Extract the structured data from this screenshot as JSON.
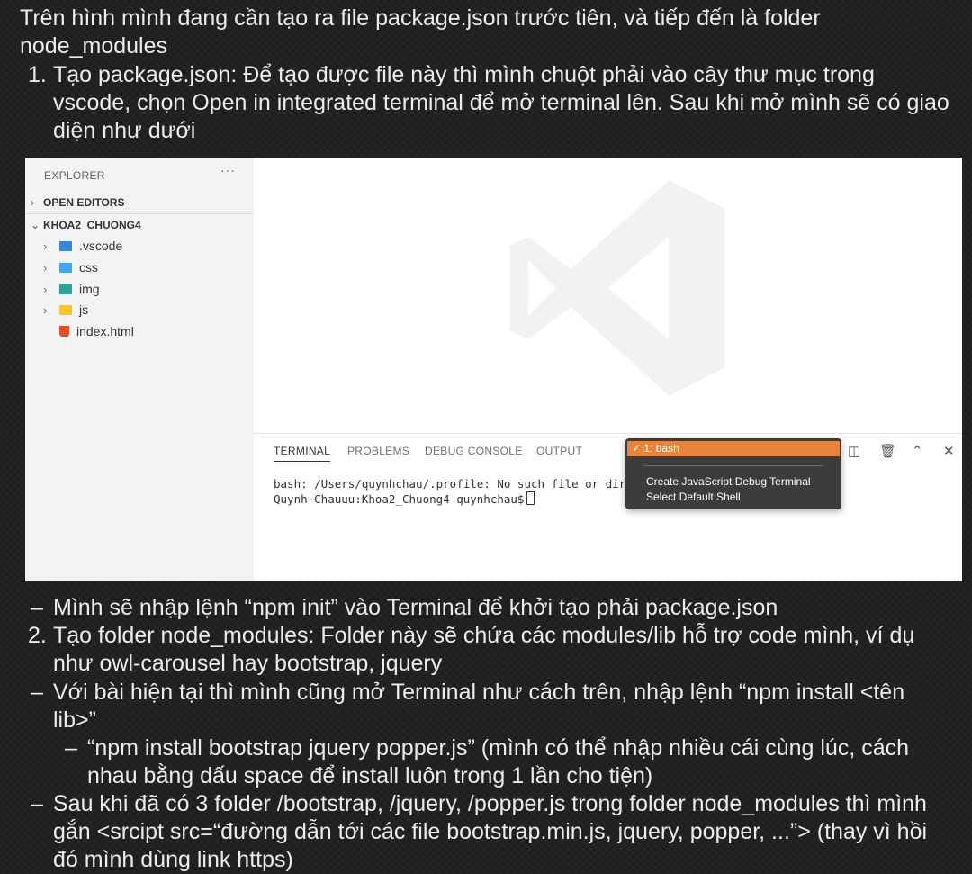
{
  "intro": {
    "line1": "Trên hình mình đang cần tạo ra file package.json trước tiên, và tiếp đến là folder",
    "line2": "node_modules"
  },
  "step1": {
    "number": "1.",
    "line1": "Tạo package.json: Để tạo được file này thì mình chuột phải vào cây thư mục trong",
    "line2": "vscode, chọn Open in integrated terminal để mở terminal lên. Sau khi mở mình sẽ có giao",
    "line3": "diện như dưới"
  },
  "vscode": {
    "explorer_title": "EXPLORER",
    "more": "···",
    "open_editors": "OPEN EDITORS",
    "project": "KHOA2_CHUONG4",
    "files": [
      {
        "name": ".vscode",
        "icon": "vscode-folder-icon",
        "color": "#3a86d6"
      },
      {
        "name": "css",
        "icon": "css-folder-icon",
        "color": "#42a5f5"
      },
      {
        "name": "img",
        "icon": "image-folder-icon",
        "color": "#26a69a"
      },
      {
        "name": "js",
        "icon": "js-folder-icon",
        "color": "#f9c623"
      },
      {
        "name": "index.html",
        "icon": "html5-icon",
        "color": "#e44d26"
      }
    ],
    "tabs": [
      "TERMINAL",
      "PROBLEMS",
      "DEBUG CONSOLE",
      "OUTPUT"
    ],
    "terminal_line1": "bash: /Users/quynhchau/.profile: No such file or dir",
    "terminal_line2": "Quynh-Chauuu:Khoa2_Chuong4 quynhchau$",
    "dropdown": {
      "selected": "1: bash",
      "option1": "Create JavaScript Debug Terminal",
      "option2": "Select Default Shell"
    },
    "accent_color": "#e8843a"
  },
  "notes": {
    "dash1": "Mình sẽ nhập lệnh “npm init” vào Terminal để khởi tạo phải package.json",
    "step2_number": "2.",
    "step2_line1": "Tạo folder node_modules: Folder này sẽ chứa các modules/lib hỗ trợ code mình, ví dụ",
    "step2_line2": "như owl-carousel hay bootstrap, jquery",
    "dash2_line1": "Với bài hiện tại thì mình cũng mở Terminal như cách trên, nhập lệnh “npm install <tên",
    "dash2_line2": "lib>”",
    "sub_line1": "“npm install bootstrap jquery popper.js” (mình có thể nhập nhiều cái cùng lúc, cách",
    "sub_line2": "nhau bằng dấu space để install luôn trong 1 lần cho tiện)",
    "dash3_line1": "Sau khi đã có 3 folder /bootstrap, /jquery, /popper.js trong folder node_modules thì mình",
    "dash3_line2": "gắn <srcipt src=“đường dẫn tới các file bootstrap.min.js, jquery, popper, ...”> (thay vì hồi",
    "dash3_line3": "đó mình dùng link https)"
  },
  "dash": "–"
}
